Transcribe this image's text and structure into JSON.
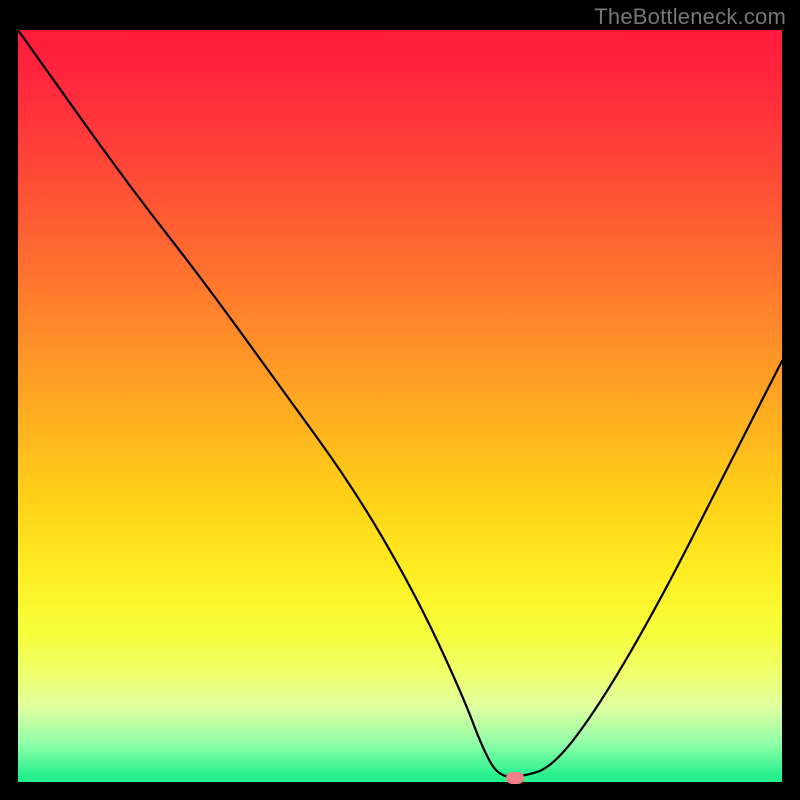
{
  "watermark": "TheBottleneck.com",
  "chart_data": {
    "type": "line",
    "title": "",
    "xlabel": "",
    "ylabel": "",
    "xlim": [
      0,
      100
    ],
    "ylim": [
      0,
      100
    ],
    "grid": false,
    "series": [
      {
        "name": "bottleneck-curve",
        "x": [
          0,
          14,
          24,
          34,
          44,
          52,
          58,
          61,
          63,
          66,
          70,
          76,
          84,
          92,
          100
        ],
        "values": [
          100,
          80,
          67,
          53,
          39,
          25,
          12,
          4,
          0.7,
          0.7,
          2,
          10,
          24,
          40,
          56
        ]
      }
    ],
    "marker": {
      "x": 65,
      "y": 0.5,
      "color": "#f08088"
    },
    "background_gradient": {
      "orientation": "vertical",
      "stops": [
        {
          "pos": 0.0,
          "color": "#ff1a3c"
        },
        {
          "pos": 0.5,
          "color": "#ffc81e"
        },
        {
          "pos": 0.82,
          "color": "#f4ff50"
        },
        {
          "pos": 1.0,
          "color": "#29f08e"
        }
      ]
    }
  }
}
